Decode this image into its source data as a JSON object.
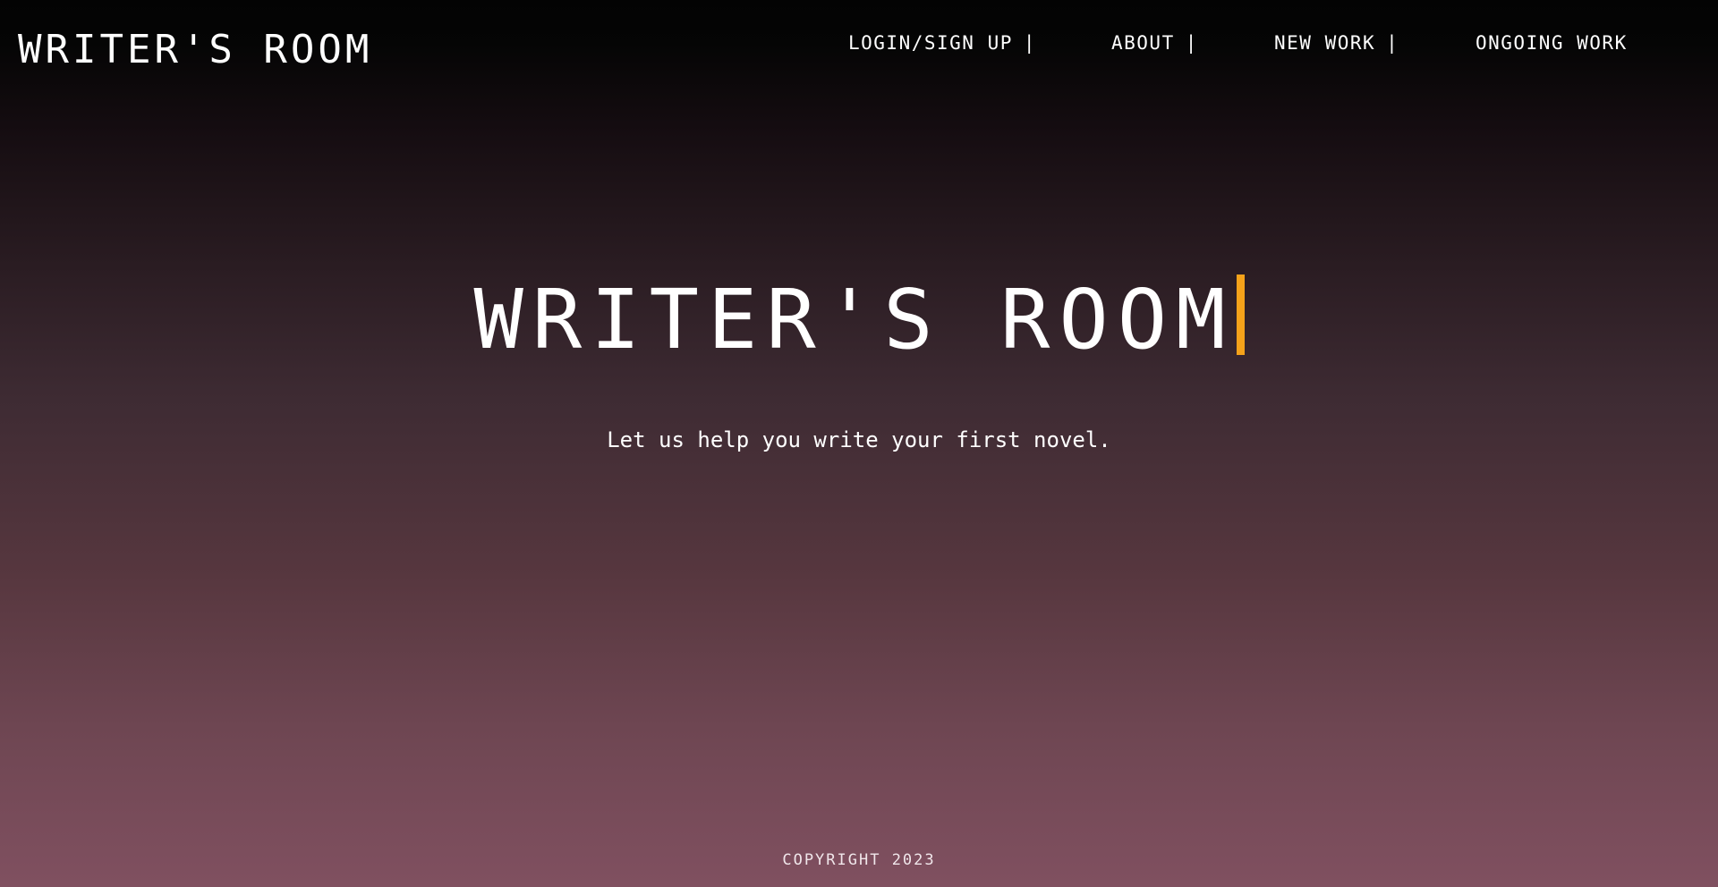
{
  "header": {
    "logo_text": "WRITER'S ROOM"
  },
  "nav": {
    "items": [
      {
        "label": "LOGIN/SIGN UP",
        "separator": "|"
      },
      {
        "label": "ABOUT",
        "separator": "|"
      },
      {
        "label": "NEW WORK",
        "separator": "|"
      },
      {
        "label": "ONGOING WORK",
        "separator": ""
      }
    ]
  },
  "hero": {
    "title": "WRITER'S ROOM",
    "tagline": "Let us help you write your first novel.",
    "cursor_color": "#f5a21a"
  },
  "footer": {
    "copyright": "COPYRIGHT 2023"
  }
}
